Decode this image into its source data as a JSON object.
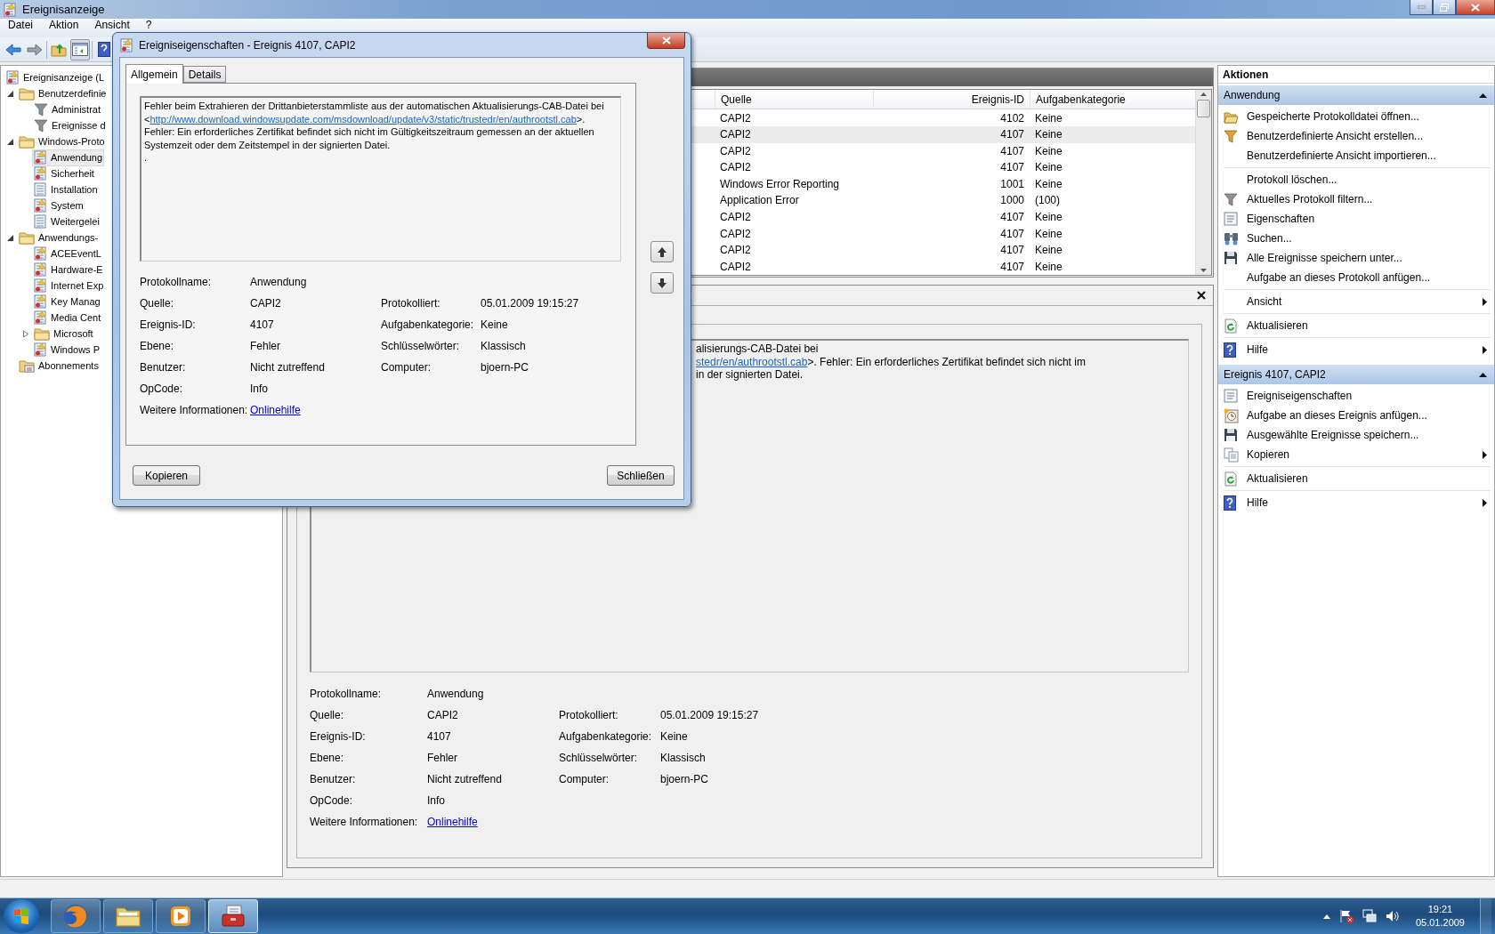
{
  "window": {
    "title": "Ereignisanzeige"
  },
  "menu": [
    "Datei",
    "Aktion",
    "Ansicht",
    "?"
  ],
  "tree": [
    {
      "label": "Ereignisanzeige (L",
      "kind": "root",
      "selected": false,
      "children": [
        {
          "label": "Benutzerdefinie",
          "kind": "folder",
          "expanded": true,
          "selected": false,
          "children": [
            {
              "label": "Administrat",
              "kind": "view",
              "selected": false
            },
            {
              "label": "Ereignisse d",
              "kind": "view",
              "selected": false
            }
          ]
        },
        {
          "label": "Windows-Proto",
          "kind": "folder",
          "expanded": true,
          "selected": false,
          "children": [
            {
              "label": "Anwendung",
              "kind": "log",
              "selected": true
            },
            {
              "label": "Sicherheit",
              "kind": "log",
              "selected": false
            },
            {
              "label": "Installation",
              "kind": "list",
              "selected": false
            },
            {
              "label": "System",
              "kind": "log",
              "selected": false
            },
            {
              "label": "Weitergelei",
              "kind": "list",
              "selected": false
            }
          ]
        },
        {
          "label": "Anwendungs-",
          "kind": "folder",
          "expanded": true,
          "selected": false,
          "children": [
            {
              "label": "ACEEventL",
              "kind": "log",
              "selected": false
            },
            {
              "label": "Hardware-E",
              "kind": "log",
              "selected": false
            },
            {
              "label": "Internet Exp",
              "kind": "log",
              "selected": false
            },
            {
              "label": "Key Manag",
              "kind": "log",
              "selected": false
            },
            {
              "label": "Media Cent",
              "kind": "log",
              "selected": false
            },
            {
              "label": "Microsoft",
              "kind": "folder",
              "expanded": false,
              "selected": false
            },
            {
              "label": "Windows P",
              "kind": "log",
              "selected": false
            }
          ]
        },
        {
          "label": "Abonnements",
          "kind": "subscriptions",
          "selected": false
        }
      ]
    }
  ],
  "events": {
    "columns": [
      "Quelle",
      "Ereignis-ID",
      "Aufgabenkategorie"
    ],
    "rows": [
      {
        "cells": [
          "CAPI2",
          "4102",
          "Keine"
        ],
        "selected": false
      },
      {
        "cells": [
          "CAPI2",
          "4107",
          "Keine"
        ],
        "selected": true
      },
      {
        "cells": [
          "CAPI2",
          "4107",
          "Keine"
        ],
        "selected": false
      },
      {
        "cells": [
          "CAPI2",
          "4107",
          "Keine"
        ],
        "selected": false
      },
      {
        "cells": [
          "Windows Error Reporting",
          "1001",
          "Keine"
        ],
        "selected": false
      },
      {
        "cells": [
          "Application Error",
          "1000",
          "(100)"
        ],
        "selected": false
      },
      {
        "cells": [
          "CAPI2",
          "4107",
          "Keine"
        ],
        "selected": false
      },
      {
        "cells": [
          "CAPI2",
          "4107",
          "Keine"
        ],
        "selected": false
      },
      {
        "cells": [
          "CAPI2",
          "4107",
          "Keine"
        ],
        "selected": false
      },
      {
        "cells": [
          "CAPI2",
          "4107",
          "Keine"
        ],
        "selected": false
      }
    ]
  },
  "detail": {
    "message": [
      {
        "text": "alisierungs-CAB-Datei bei"
      },
      {
        "link": "stedr/en/authrootstl.cab",
        "text": ">. Fehler: Ein erforderliches Zertifikat befindet sich nicht im"
      },
      {
        "text": "in der signierten Datei."
      }
    ],
    "fields": [
      {
        "left": {
          "label": "Protokollname:",
          "value": "Anwendung",
          "kind": "text"
        }
      },
      {
        "left": {
          "label": "Quelle:",
          "value": "CAPI2",
          "kind": "text"
        },
        "right": {
          "label": "Protokolliert:",
          "value": "05.01.2009 19:15:27",
          "kind": "text"
        }
      },
      {
        "left": {
          "label": "Ereignis-ID:",
          "value": "4107",
          "kind": "text"
        },
        "right": {
          "label": "Aufgabenkategorie:",
          "value": "Keine",
          "kind": "text"
        }
      },
      {
        "left": {
          "label": "Ebene:",
          "value": "Fehler",
          "kind": "text"
        },
        "right": {
          "label": "Schlüsselwörter:",
          "value": "Klassisch",
          "kind": "text"
        }
      },
      {
        "left": {
          "label": "Benutzer:",
          "value": "Nicht zutreffend",
          "kind": "text"
        },
        "right": {
          "label": "Computer:",
          "value": "bjoern-PC",
          "kind": "text"
        }
      },
      {
        "left": {
          "label": "OpCode:",
          "value": "Info",
          "kind": "text"
        }
      },
      {
        "left": {
          "label": "Weitere Informationen:",
          "value": "Onlinehilfe",
          "kind": "link"
        }
      }
    ]
  },
  "actions": {
    "title": "Aktionen",
    "sections": [
      {
        "title": "Anwendung",
        "expanded": true,
        "groups": [
          [
            {
              "label": "Gespeicherte Protokolldatei öffnen...",
              "submenu": false
            },
            {
              "label": "Benutzerdefinierte Ansicht erstellen...",
              "submenu": false
            },
            {
              "label": "Benutzerdefinierte Ansicht importieren...",
              "submenu": false
            }
          ],
          [
            {
              "label": "Protokoll löschen...",
              "submenu": false
            },
            {
              "label": "Aktuelles Protokoll filtern...",
              "submenu": false
            },
            {
              "label": "Eigenschaften",
              "submenu": false
            },
            {
              "label": "Suchen...",
              "submenu": false
            },
            {
              "label": "Alle Ereignisse speichern unter...",
              "submenu": false
            },
            {
              "label": "Aufgabe an dieses Protokoll anfügen...",
              "submenu": false
            }
          ],
          [
            {
              "label": "Ansicht",
              "submenu": true
            }
          ],
          [
            {
              "label": "Aktualisieren",
              "submenu": false
            }
          ],
          [
            {
              "label": "Hilfe",
              "submenu": true
            }
          ]
        ]
      },
      {
        "title": "Ereignis 4107, CAPI2",
        "expanded": true,
        "groups": [
          [
            {
              "label": "Ereigniseigenschaften",
              "submenu": false
            },
            {
              "label": "Aufgabe an dieses Ereignis anfügen...",
              "submenu": false
            },
            {
              "label": "Ausgewählte Ereignisse speichern...",
              "submenu": false
            },
            {
              "label": "Kopieren",
              "submenu": true
            }
          ],
          [
            {
              "label": "Aktualisieren",
              "submenu": false
            }
          ],
          [
            {
              "label": "Hilfe",
              "submenu": true
            }
          ]
        ]
      }
    ]
  },
  "dialog": {
    "title": "Ereigniseigenschaften - Ereignis 4107, CAPI2",
    "tabs": [
      {
        "label": "Allgemein",
        "selected": true
      },
      {
        "label": "Details",
        "selected": false
      }
    ],
    "message": {
      "before": "Fehler beim Extrahieren der Drittanbieterstammliste aus der automatischen Aktualisierungs-CAB-Datei bei <",
      "link": "http://www.download.windowsupdate.com/msdownload/update/v3/static/trustedr/en/authrootstl.cab",
      "after": ">. Fehler: Ein erforderliches Zertifikat befindet sich nicht im Gültigkeitszeitraum gemessen an der aktuellen Systemzeit oder dem Zeitstempel in der signierten Datei.",
      "trailing": "."
    },
    "fields": [
      {
        "left": {
          "label": "Protokollname:",
          "value": "Anwendung",
          "kind": "text"
        }
      },
      {
        "left": {
          "label": "Quelle:",
          "value": "CAPI2",
          "kind": "text"
        },
        "right": {
          "label": "Protokolliert:",
          "value": "05.01.2009 19:15:27",
          "kind": "text"
        }
      },
      {
        "left": {
          "label": "Ereignis-ID:",
          "value": "4107",
          "kind": "text"
        },
        "right": {
          "label": "Aufgabenkategorie:",
          "value": "Keine",
          "kind": "text"
        }
      },
      {
        "left": {
          "label": "Ebene:",
          "value": "Fehler",
          "kind": "text"
        },
        "right": {
          "label": "Schlüsselwörter:",
          "value": "Klassisch",
          "kind": "text"
        }
      },
      {
        "left": {
          "label": "Benutzer:",
          "value": "Nicht zutreffend",
          "kind": "text"
        },
        "right": {
          "label": "Computer:",
          "value": "bjoern-PC",
          "kind": "text"
        }
      },
      {
        "left": {
          "label": "OpCode:",
          "value": "Info",
          "kind": "text"
        }
      },
      {
        "left": {
          "label": "Weitere Informationen:",
          "value": "Onlinehilfe",
          "kind": "link"
        }
      }
    ],
    "buttons": [
      "Kopieren",
      "Schließen"
    ]
  },
  "taskbar": {
    "apps": [
      {
        "selected": false
      },
      {
        "selected": false
      },
      {
        "selected": false
      },
      {
        "selected": true
      }
    ],
    "clock": {
      "time": "19:21",
      "date": "05.01.2009"
    }
  }
}
